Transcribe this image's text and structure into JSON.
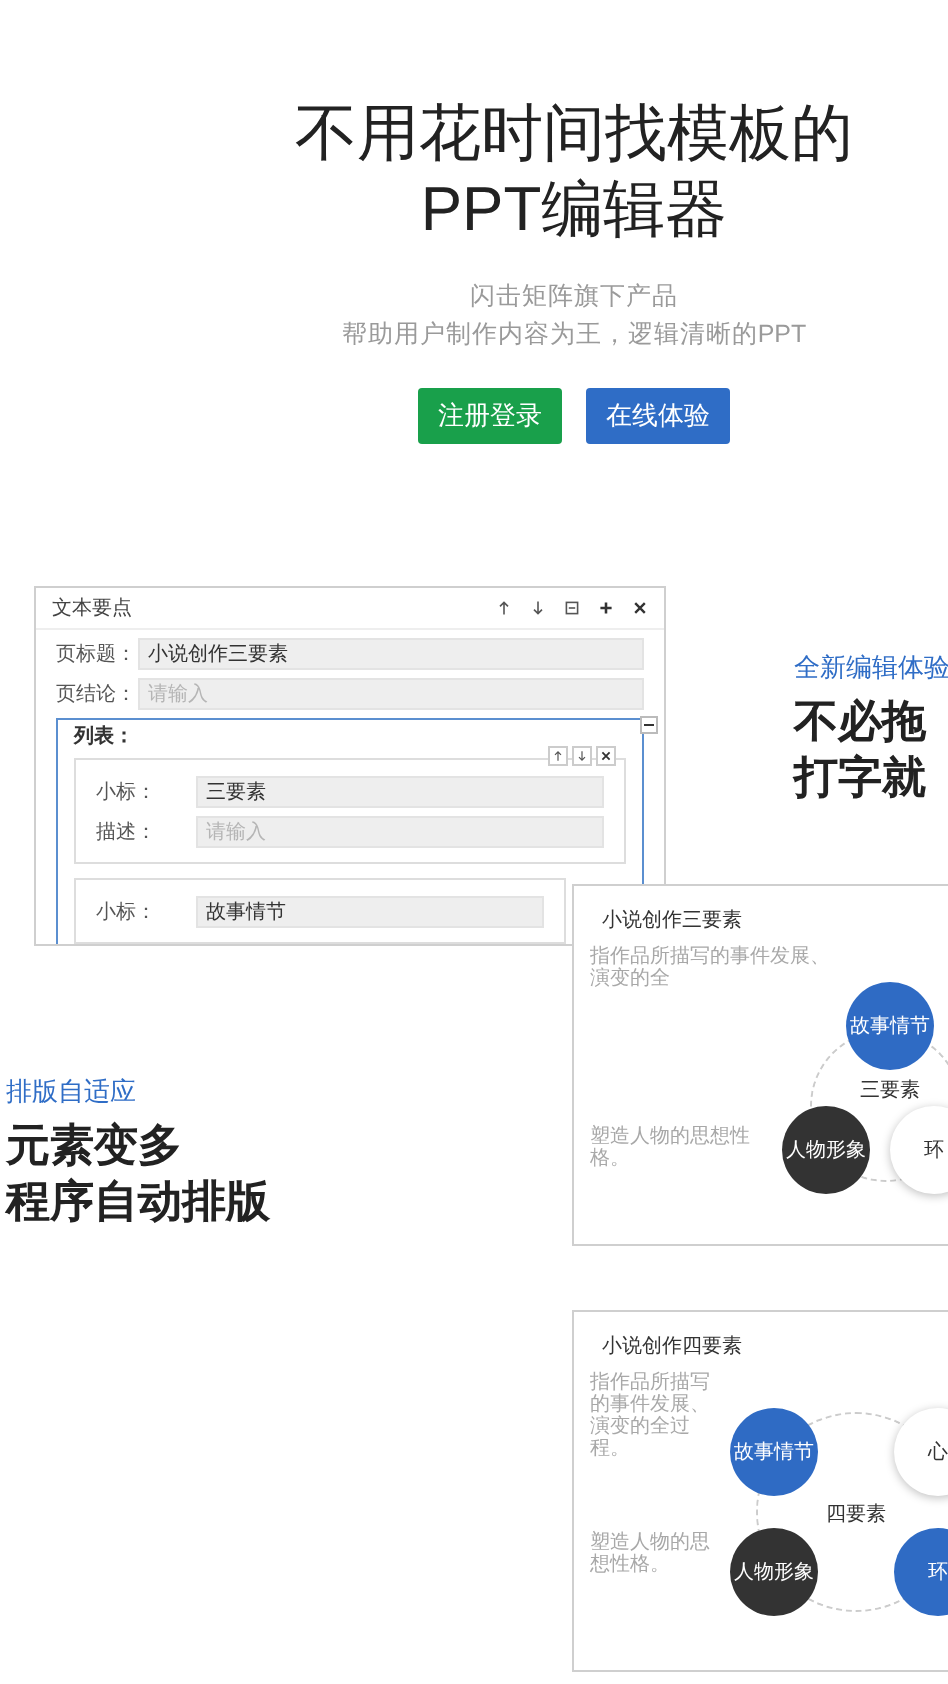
{
  "hero": {
    "title_lines": [
      "不用花时间找模板的",
      "PPT编辑器"
    ],
    "subtitle_lines": [
      "闪击矩阵旗下产品",
      "帮助用户制作内容为王，逻辑清晰的PPT"
    ],
    "buttons": [
      {
        "label": "注册登录",
        "color": "#19a04b"
      },
      {
        "label": "在线体验",
        "color": "#2f6dc6"
      }
    ]
  },
  "editor_mock": {
    "title": "文本要点",
    "fields": [
      {
        "label": "页标题：",
        "value": "小说创作三要素"
      },
      {
        "label": "页结论：",
        "placeholder": "请输入"
      }
    ],
    "list_label": "列表：",
    "items": [
      {
        "fields": [
          {
            "label": "小标：",
            "value": "三要素"
          },
          {
            "label": "描述：",
            "placeholder": "请输入"
          }
        ]
      },
      {
        "fields": [
          {
            "label": "小标：",
            "value": "故事情节"
          }
        ]
      }
    ]
  },
  "features": [
    {
      "tagline": "全新编辑体验",
      "headline_lines": [
        "不必拖",
        "打字就"
      ]
    },
    {
      "tagline": "排版自适应",
      "headline_lines": [
        "元素变多",
        "程序自动排版"
      ]
    }
  ],
  "slides": [
    {
      "kind": "three",
      "title": "小说创作三要素",
      "center_label": "三要素",
      "captions": [
        "指作品所描写的事件发展、演变的全",
        "塑造人物的思想性格。"
      ],
      "nodes": [
        {
          "label": "故事情节",
          "color": "#2f6bc4"
        },
        {
          "label": "人物形象",
          "color": "#333333"
        },
        {
          "label": "环",
          "color": "#ffffff"
        }
      ]
    },
    {
      "kind": "four",
      "title": "小说创作四要素",
      "center_label": "四要素",
      "captions": [
        "指作品所描写的事件发展、演变的全过程。",
        "塑造人物的思想性格。"
      ],
      "nodes": [
        {
          "label": "故事情节",
          "color": "#2f6bc4"
        },
        {
          "label": "心",
          "color": "#ffffff"
        },
        {
          "label": "人物形象",
          "color": "#333333"
        },
        {
          "label": "环",
          "color": "#2f6bc4"
        }
      ]
    }
  ]
}
